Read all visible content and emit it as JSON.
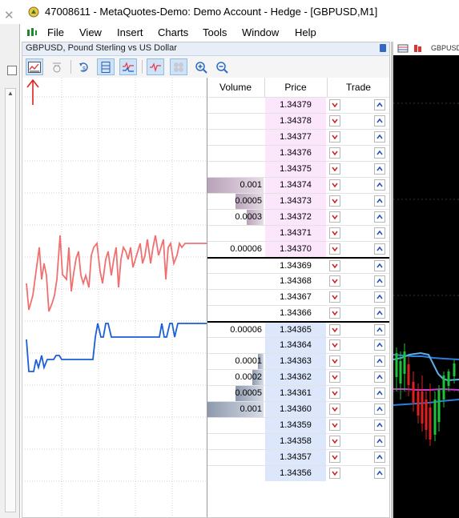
{
  "window": {
    "title": "47008611 - MetaQuotes-Demo: Demo Account - Hedge - [GBPUSD,M1]"
  },
  "menu": [
    "File",
    "View",
    "Insert",
    "Charts",
    "Tools",
    "Window",
    "Help"
  ],
  "dom": {
    "header": "GBPUSD, Pound Sterling vs US Dollar",
    "columns": {
      "volume": "Volume",
      "price": "Price",
      "trade": "Trade"
    },
    "rows": [
      {
        "price": "1.34379",
        "volume": "",
        "side": "ask",
        "depth": 0
      },
      {
        "price": "1.34378",
        "volume": "",
        "side": "ask",
        "depth": 0
      },
      {
        "price": "1.34377",
        "volume": "",
        "side": "ask",
        "depth": 0
      },
      {
        "price": "1.34376",
        "volume": "",
        "side": "ask",
        "depth": 0
      },
      {
        "price": "1.34375",
        "volume": "",
        "side": "ask",
        "depth": 0
      },
      {
        "price": "1.34374",
        "volume": "0.001",
        "side": "ask",
        "depth": 1.0
      },
      {
        "price": "1.34373",
        "volume": "0.0005",
        "side": "ask",
        "depth": 0.5
      },
      {
        "price": "1.34372",
        "volume": "0.0003",
        "side": "ask",
        "depth": 0.3
      },
      {
        "price": "1.34371",
        "volume": "",
        "side": "ask",
        "depth": 0
      },
      {
        "price": "1.34370",
        "volume": "0.00006",
        "side": "ask",
        "depth": 0
      },
      {
        "price": "1.34369",
        "volume": "",
        "side": "none",
        "depth": 0
      },
      {
        "price": "1.34368",
        "volume": "",
        "side": "none",
        "depth": 0
      },
      {
        "price": "1.34367",
        "volume": "",
        "side": "none",
        "depth": 0
      },
      {
        "price": "1.34366",
        "volume": "",
        "side": "none",
        "depth": 0
      },
      {
        "price": "1.34365",
        "volume": "0.00006",
        "side": "bid",
        "depth": 0
      },
      {
        "price": "1.34364",
        "volume": "",
        "side": "bid",
        "depth": 0
      },
      {
        "price": "1.34363",
        "volume": "0.0001",
        "side": "bid",
        "depth": 0.1
      },
      {
        "price": "1.34362",
        "volume": "0.0002",
        "side": "bid",
        "depth": 0.2
      },
      {
        "price": "1.34361",
        "volume": "0.0005",
        "side": "bid",
        "depth": 0.5
      },
      {
        "price": "1.34360",
        "volume": "0.001",
        "side": "bid",
        "depth": 1.0
      },
      {
        "price": "1.34359",
        "volume": "",
        "side": "bid",
        "depth": 0
      },
      {
        "price": "1.34358",
        "volume": "",
        "side": "bid",
        "depth": 0
      },
      {
        "price": "1.34357",
        "volume": "",
        "side": "bid",
        "depth": 0
      },
      {
        "price": "1.34356",
        "volume": "",
        "side": "bid",
        "depth": 0
      }
    ]
  },
  "right_chart": {
    "header": "GBPUSD"
  },
  "colors": {
    "ask_line": "#f07070",
    "bid_line": "#1a5fd8",
    "ask_bg": "#fce6fb",
    "bid_bg": "#dde7fb",
    "arrow": "#e02020"
  },
  "toolbar_icons": [
    "chart-icon",
    "depth-icon",
    "one-click-icon",
    "split-icon",
    "ticks-icon",
    "trades-icon",
    "volume-icon",
    "zoom-in-icon",
    "zoom-out-icon"
  ]
}
